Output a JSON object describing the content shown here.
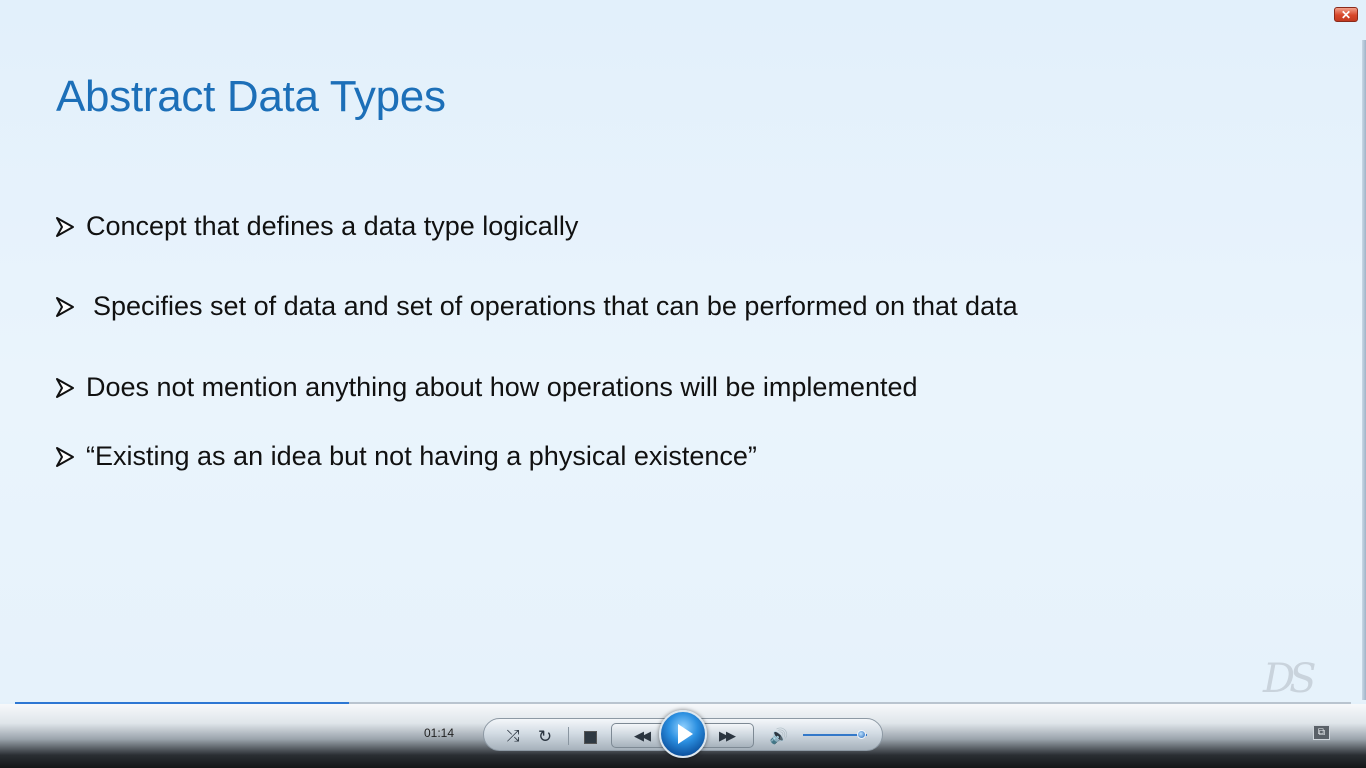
{
  "window": {
    "close_glyph": "✕"
  },
  "slide": {
    "title": "Abstract Data Types",
    "bullets": [
      "Concept that defines a data type logically",
      "Specifies set of data and set of operations that can be performed on that data",
      "Does not mention anything about how operations will be implemented",
      "“Existing as an idea but not having a physical existence”"
    ],
    "logo_text": "DS"
  },
  "player": {
    "elapsed_time": "01:14",
    "progress_fraction": 0.25,
    "volume_fraction": 0.9,
    "icons": {
      "shuffle": "⤮",
      "repeat": "↻",
      "rewind": "◀◀",
      "fast_forward": "▶▶",
      "volume": "🔊",
      "switch_view": "⧉"
    },
    "accent_color": "#2d77d3"
  }
}
